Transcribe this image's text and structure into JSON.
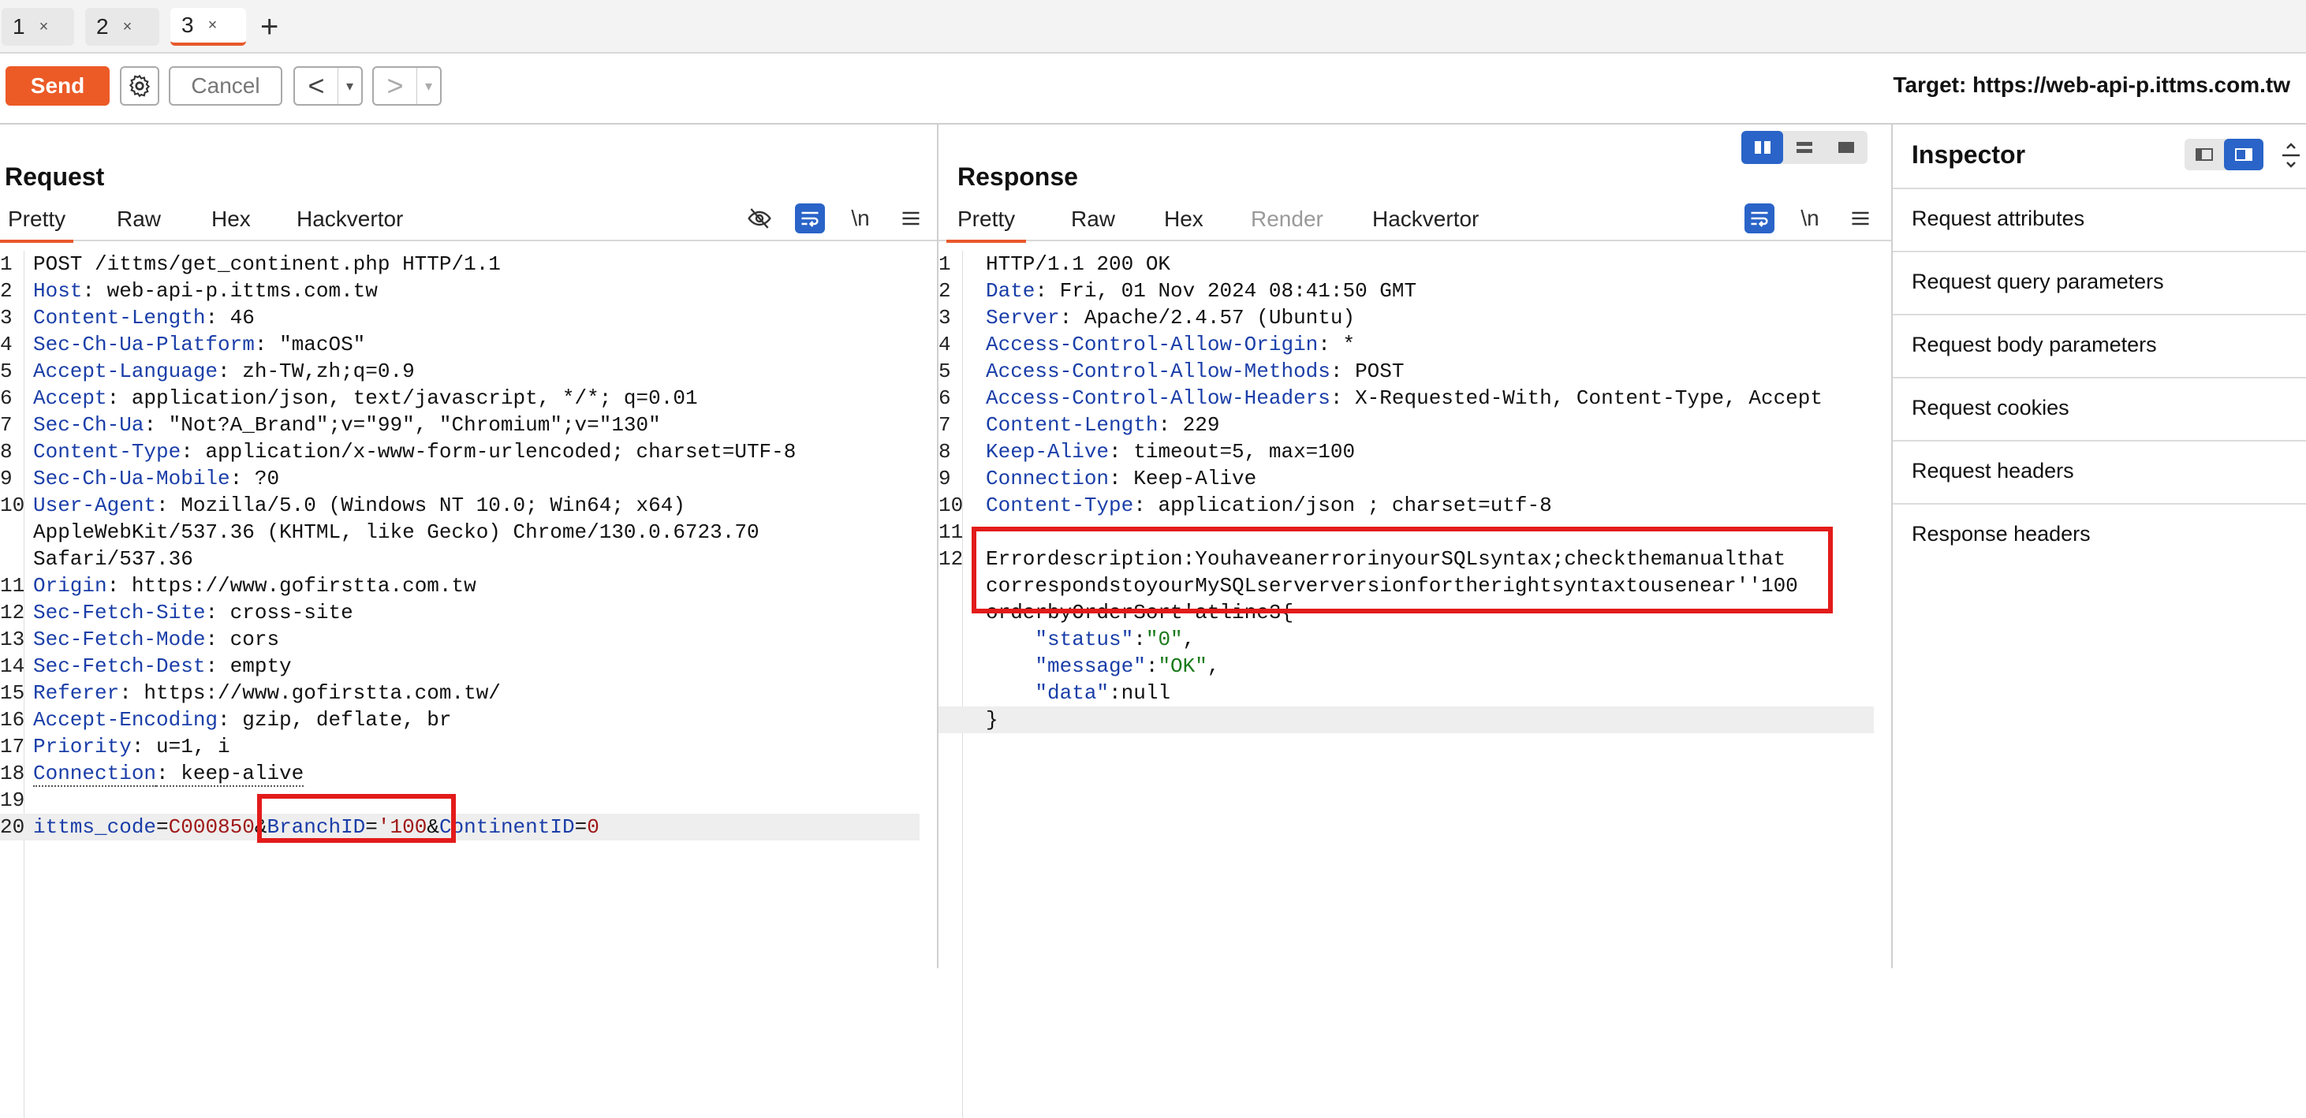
{
  "tabs": [
    {
      "label": "1",
      "close": "×"
    },
    {
      "label": "2",
      "close": "×"
    },
    {
      "label": "3",
      "close": "×"
    }
  ],
  "new_tab": "+",
  "toolbar": {
    "send_label": "Send",
    "cancel_label": "Cancel",
    "back_glyph": "<",
    "forward_glyph": ">",
    "dropdown_glyph": "▾",
    "target": "Target: https://web-api-p.ittms.com.tw"
  },
  "request": {
    "title": "Request",
    "tabs": [
      "Pretty",
      "Raw",
      "Hex",
      "Hackvertor"
    ],
    "icons": [
      "hide-icon",
      "wrap-icon",
      "newline-icon",
      "menu-icon"
    ],
    "newline_glyph": "\\n",
    "lines": [
      {
        "n": "1",
        "parts": [
          {
            "t": "POST /ittms/get_continent.php HTTP/1.1",
            "c": "v"
          }
        ]
      },
      {
        "n": "2",
        "parts": [
          {
            "t": "Host",
            "c": "k"
          },
          {
            "t": ": web-api-p.ittms.com.tw",
            "c": "v"
          }
        ]
      },
      {
        "n": "3",
        "parts": [
          {
            "t": "Content-Length",
            "c": "k"
          },
          {
            "t": ": 46",
            "c": "v"
          }
        ]
      },
      {
        "n": "4",
        "parts": [
          {
            "t": "Sec-Ch-Ua-Platform",
            "c": "k"
          },
          {
            "t": ": \"macOS\"",
            "c": "v"
          }
        ]
      },
      {
        "n": "5",
        "parts": [
          {
            "t": "Accept-Language",
            "c": "k"
          },
          {
            "t": ": zh-TW,zh;q=0.9",
            "c": "v"
          }
        ]
      },
      {
        "n": "6",
        "parts": [
          {
            "t": "Accept",
            "c": "k"
          },
          {
            "t": ": application/json, text/javascript, */*; q=0.01",
            "c": "v"
          }
        ]
      },
      {
        "n": "7",
        "parts": [
          {
            "t": "Sec-Ch-Ua",
            "c": "k"
          },
          {
            "t": ": \"Not?A_Brand\";v=\"99\", \"Chromium\";v=\"130\"",
            "c": "v"
          }
        ]
      },
      {
        "n": "8",
        "parts": [
          {
            "t": "Content-Type",
            "c": "k"
          },
          {
            "t": ": application/x-www-form-urlencoded; charset=UTF-8",
            "c": "v"
          }
        ]
      },
      {
        "n": "9",
        "parts": [
          {
            "t": "Sec-Ch-Ua-Mobile",
            "c": "k"
          },
          {
            "t": ": ?0",
            "c": "v"
          }
        ]
      },
      {
        "n": "10",
        "parts": [
          {
            "t": "User-Agent",
            "c": "k"
          },
          {
            "t": ": Mozilla/5.0 (Windows NT 10.0; Win64; x64)",
            "c": "v"
          }
        ]
      },
      {
        "n": "",
        "parts": [
          {
            "t": "AppleWebKit/537.36 (KHTML, like Gecko) Chrome/130.0.6723.70",
            "c": "v"
          }
        ]
      },
      {
        "n": "",
        "parts": [
          {
            "t": "Safari/537.36",
            "c": "v"
          }
        ]
      },
      {
        "n": "11",
        "parts": [
          {
            "t": "Origin",
            "c": "k"
          },
          {
            "t": ": https://www.gofirstta.com.tw",
            "c": "v"
          }
        ]
      },
      {
        "n": "12",
        "parts": [
          {
            "t": "Sec-Fetch-Site",
            "c": "k"
          },
          {
            "t": ": cross-site",
            "c": "v"
          }
        ]
      },
      {
        "n": "13",
        "parts": [
          {
            "t": "Sec-Fetch-Mode",
            "c": "k"
          },
          {
            "t": ": cors",
            "c": "v"
          }
        ]
      },
      {
        "n": "14",
        "parts": [
          {
            "t": "Sec-Fetch-Dest",
            "c": "k"
          },
          {
            "t": ": empty",
            "c": "v"
          }
        ]
      },
      {
        "n": "15",
        "parts": [
          {
            "t": "Referer",
            "c": "k"
          },
          {
            "t": ": https://www.gofirstta.com.tw/",
            "c": "v"
          }
        ]
      },
      {
        "n": "16",
        "parts": [
          {
            "t": "Accept-Encoding",
            "c": "k"
          },
          {
            "t": ": gzip, deflate, br",
            "c": "v"
          }
        ]
      },
      {
        "n": "17",
        "parts": [
          {
            "t": "Priority",
            "c": "k"
          },
          {
            "t": ": u=1, i",
            "c": "v"
          }
        ]
      },
      {
        "n": "18",
        "parts": [
          {
            "t": "Connection",
            "c": "k"
          },
          {
            "t": ": keep-alive",
            "c": "v"
          }
        ]
      },
      {
        "n": "19",
        "parts": []
      },
      {
        "n": "20",
        "parts": [
          {
            "t": "ittms_code",
            "c": "k"
          },
          {
            "t": "=",
            "c": "v"
          },
          {
            "t": "C000850",
            "c": "s"
          },
          {
            "t": "&",
            "c": "v"
          },
          {
            "t": "BranchID",
            "c": "k"
          },
          {
            "t": "=",
            "c": "v"
          },
          {
            "t": "'100",
            "c": "s"
          },
          {
            "t": "&",
            "c": "v"
          },
          {
            "t": "ContinentID",
            "c": "k"
          },
          {
            "t": "=",
            "c": "v"
          },
          {
            "t": "0",
            "c": "s"
          }
        ]
      }
    ]
  },
  "response": {
    "title": "Response",
    "tabs": [
      "Pretty",
      "Raw",
      "Hex",
      "Render",
      "Hackvertor"
    ],
    "newline_glyph": "\\n",
    "lines": [
      {
        "n": "1",
        "parts": [
          {
            "t": "HTTP/1.1 200 OK",
            "c": "v"
          }
        ]
      },
      {
        "n": "2",
        "parts": [
          {
            "t": "Date",
            "c": "k"
          },
          {
            "t": ": Fri, 01 Nov 2024 08:41:50 GMT",
            "c": "v"
          }
        ]
      },
      {
        "n": "3",
        "parts": [
          {
            "t": "Server",
            "c": "k"
          },
          {
            "t": ": Apache/2.4.57 (Ubuntu)",
            "c": "v"
          }
        ]
      },
      {
        "n": "4",
        "parts": [
          {
            "t": "Access-Control-Allow-Origin",
            "c": "k"
          },
          {
            "t": ": *",
            "c": "v"
          }
        ]
      },
      {
        "n": "5",
        "parts": [
          {
            "t": "Access-Control-Allow-Methods",
            "c": "k"
          },
          {
            "t": ": POST",
            "c": "v"
          }
        ]
      },
      {
        "n": "6",
        "parts": [
          {
            "t": "Access-Control-Allow-Headers",
            "c": "k"
          },
          {
            "t": ": X-Requested-With, Content-Type, Accept",
            "c": "v"
          }
        ]
      },
      {
        "n": "7",
        "parts": [
          {
            "t": "Content-Length",
            "c": "k"
          },
          {
            "t": ": 229",
            "c": "v"
          }
        ]
      },
      {
        "n": "8",
        "parts": [
          {
            "t": "Keep-Alive",
            "c": "k"
          },
          {
            "t": ": timeout=5, max=100",
            "c": "v"
          }
        ]
      },
      {
        "n": "9",
        "parts": [
          {
            "t": "Connection",
            "c": "k"
          },
          {
            "t": ": Keep-Alive",
            "c": "v"
          }
        ]
      },
      {
        "n": "10",
        "parts": [
          {
            "t": "Content-Type",
            "c": "k"
          },
          {
            "t": ": application/json ; charset=utf-8",
            "c": "v"
          }
        ]
      },
      {
        "n": "11",
        "parts": []
      },
      {
        "n": "12",
        "parts": [
          {
            "t": "Errordescription:YouhaveanerrorinyourSQLsyntax;checkthemanualthat",
            "c": "v"
          }
        ]
      },
      {
        "n": "",
        "parts": [
          {
            "t": "correspondstoyourMySQLserverversionfortherightsyntaxtousenear''100",
            "c": "v"
          }
        ]
      },
      {
        "n": "",
        "parts": [
          {
            "t": "orderbyOrderSort'atline3{",
            "c": "v"
          }
        ]
      },
      {
        "n": "",
        "parts": [
          {
            "t": "    \"status\"",
            "c": "k"
          },
          {
            "t": ":",
            "c": "v"
          },
          {
            "t": "\"0\"",
            "c": "gr"
          },
          {
            "t": ",",
            "c": "v"
          }
        ]
      },
      {
        "n": "",
        "parts": [
          {
            "t": "    \"message\"",
            "c": "k"
          },
          {
            "t": ":",
            "c": "v"
          },
          {
            "t": "\"OK\"",
            "c": "gr"
          },
          {
            "t": ",",
            "c": "v"
          }
        ]
      },
      {
        "n": "",
        "parts": [
          {
            "t": "    \"data\"",
            "c": "k"
          },
          {
            "t": ":null",
            "c": "v"
          }
        ]
      },
      {
        "n": "",
        "parts": [
          {
            "t": "}",
            "c": "v"
          }
        ]
      }
    ]
  },
  "inspector": {
    "title": "Inspector",
    "items": [
      "Request attributes",
      "Request query parameters",
      "Request body parameters",
      "Request cookies",
      "Request headers",
      "Response headers"
    ]
  }
}
